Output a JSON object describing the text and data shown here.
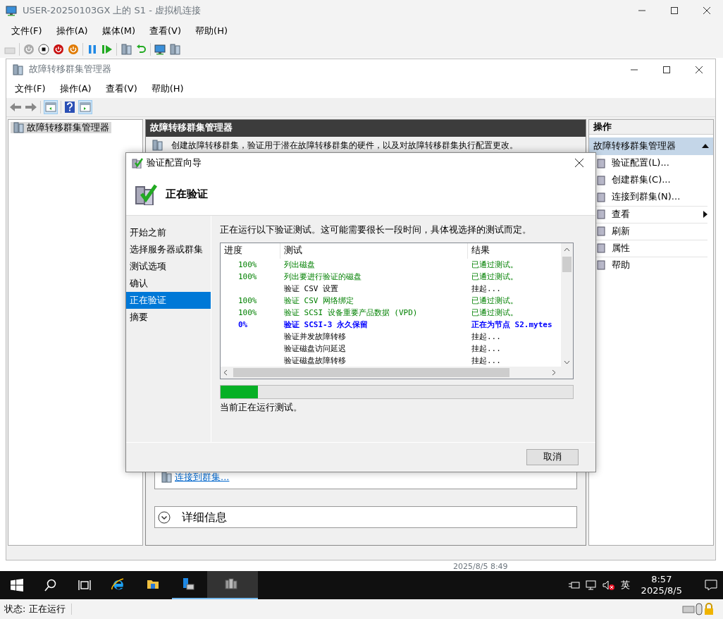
{
  "vm_window": {
    "title": "USER-20250103GX 上的 S1 - 虚拟机连接",
    "menu": [
      "文件(F)",
      "操作(A)",
      "媒体(M)",
      "查看(V)",
      "帮助(H)"
    ]
  },
  "mmc": {
    "title": "故障转移群集管理器",
    "menu": [
      "文件(F)",
      "操作(A)",
      "查看(V)",
      "帮助(H)"
    ],
    "tree": [
      {
        "label": "故障转移群集管理器",
        "selected": true
      }
    ],
    "center": {
      "header": "故障转移群集管理器",
      "description": "创建故障转移群集，验证用于潜在故障转移群集的硬件，以及对故障转移群集执行配置更改。",
      "link": "连接到群集...",
      "details": "详细信息"
    },
    "actions": {
      "header": "操作",
      "group": "故障转移群集管理器",
      "items": [
        {
          "label": "验证配置(L)...",
          "kind": "action"
        },
        {
          "label": "创建群集(C)...",
          "kind": "action"
        },
        {
          "label": "连接到群集(N)...",
          "kind": "action"
        },
        {
          "label": "查看",
          "kind": "submenu"
        },
        {
          "label": "刷新",
          "kind": "action"
        },
        {
          "label": "属性",
          "kind": "action"
        },
        {
          "label": "帮助",
          "kind": "action"
        }
      ]
    }
  },
  "behind_text": "2025/8/5 8:49",
  "wizard": {
    "title": "验证配置向导",
    "heading": "正在验证",
    "steps": [
      {
        "label": "开始之前",
        "selected": false
      },
      {
        "label": "选择服务器或群集",
        "selected": false
      },
      {
        "label": "测试选项",
        "selected": false
      },
      {
        "label": "确认",
        "selected": false
      },
      {
        "label": "正在验证",
        "selected": true
      },
      {
        "label": "摘要",
        "selected": false
      }
    ],
    "intro": "正在运行以下验证测试。这可能需要很长一段时间，具体视选择的测试而定。",
    "columns": [
      "进度",
      "测试",
      "结果"
    ],
    "rows": [
      {
        "progress": "100%",
        "test": "列出磁盘",
        "result": "已通过测试。",
        "kind": "passed"
      },
      {
        "progress": "100%",
        "test": "列出要进行验证的磁盘",
        "result": "已通过测试。",
        "kind": "passed"
      },
      {
        "test": "验证 CSV 设置",
        "result": "挂起...",
        "kind": "pending"
      },
      {
        "progress": "100%",
        "test": "验证 CSV 网络绑定",
        "result": "已通过测试。",
        "kind": "passed"
      },
      {
        "progress": "100%",
        "test": "验证 SCSI 设备重要产品数据 (VPD)",
        "result": "已通过测试。",
        "kind": "passed"
      },
      {
        "progress": "0%",
        "test": "验证 SCSI-3 永久保留",
        "result": "正在为节点 S2.mytes",
        "kind": "running"
      },
      {
        "test": "验证并发故障转移",
        "result": "挂起...",
        "kind": "pending"
      },
      {
        "test": "验证磁盘访问延迟",
        "result": "挂起...",
        "kind": "pending"
      },
      {
        "test": "验证磁盘故障转移",
        "result": "挂起...",
        "kind": "pending"
      }
    ],
    "progress": {
      "level": 0.105
    },
    "status_text": "当前正在运行测试。",
    "cancel": "取消"
  },
  "taskbar": {
    "apps": [
      {
        "kind": "ie",
        "running": false,
        "selected": false
      },
      {
        "kind": "explorer",
        "running": false,
        "selected": false
      },
      {
        "kind": "server-manager",
        "running": true,
        "selected": false
      },
      {
        "kind": "cluster",
        "running": true,
        "selected": true
      }
    ],
    "ime": "英",
    "time": "8:57",
    "date": "2025/8/5"
  },
  "status_bar": "状态: 正在运行"
}
